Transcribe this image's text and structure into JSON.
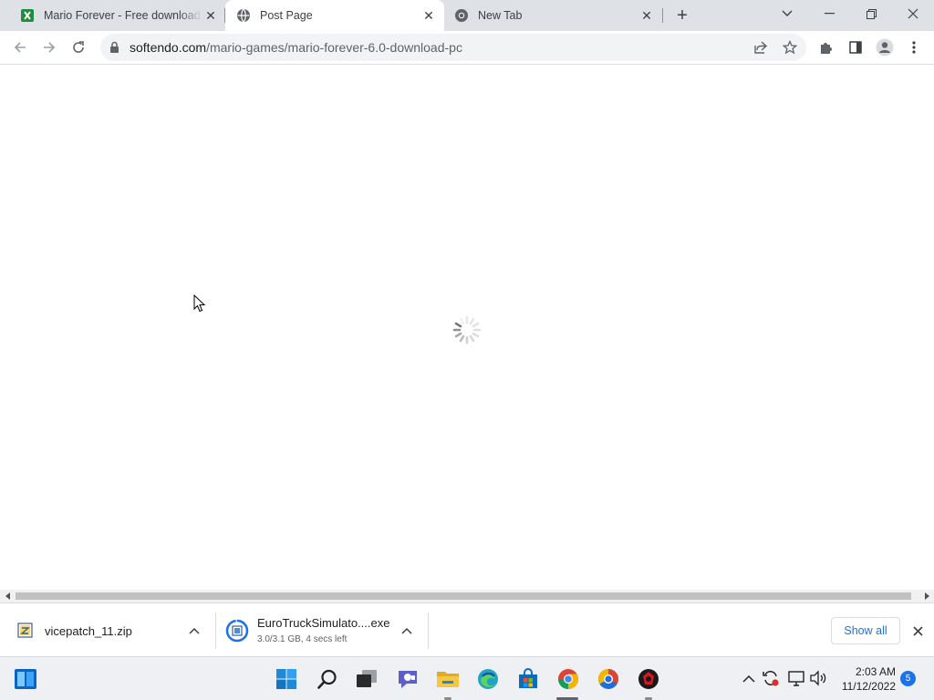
{
  "browser": {
    "tabs": [
      {
        "title": "Mario Forever - Free download a",
        "favicon": "sheets-green-icon",
        "active": false
      },
      {
        "title": "Post Page",
        "favicon": "globe-icon",
        "active": true
      },
      {
        "title": "New Tab",
        "favicon": "chrome-icon",
        "active": false
      }
    ],
    "close_glyph": "✕",
    "new_tab_glyph": "+",
    "address": {
      "domain": "softendo.com",
      "path": "/mario-games/mario-forever-6.0-download-pc"
    }
  },
  "page": {
    "state": "loading-spinner"
  },
  "downloads": {
    "items": [
      {
        "name": "vicepatch_11.zip",
        "status": "",
        "icon": "zip-file-icon"
      },
      {
        "name": "EuroTruckSimulato....exe",
        "status": "3.0/3.1 GB, 4 secs left",
        "icon": "installer-progress-icon",
        "progress": 0.97
      }
    ],
    "show_all_label": "Show all"
  },
  "taskbar": {
    "apps": [
      "widgets-icon",
      "windows-start-icon",
      "search-icon",
      "task-view-icon",
      "teams-chat-icon",
      "file-explorer-icon",
      "edge-icon",
      "store-icon",
      "chrome-icon",
      "chromium-icon",
      "red-app-icon"
    ],
    "clock": {
      "time": "2:03 AM",
      "date": "11/12/2022"
    },
    "notifications": "5"
  },
  "colors": {
    "tabstrip": "#dee1e6",
    "accent": "#1a73e8",
    "taskbar": "#eef0f3"
  }
}
